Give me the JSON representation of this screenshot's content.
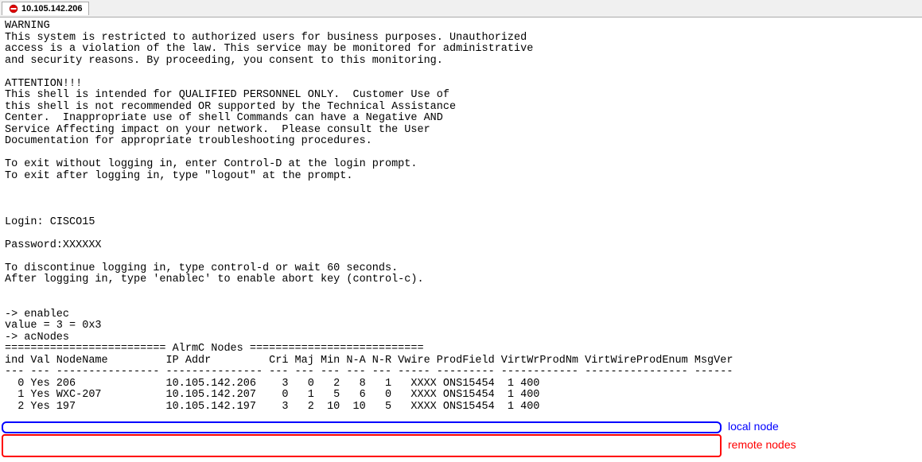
{
  "tab": {
    "title": "10.105.142.206"
  },
  "terminal": {
    "warning_header": "WARNING",
    "warning_lines": [
      "This system is restricted to authorized users for business purposes. Unauthorized",
      "access is a violation of the law. This service may be monitored for administrative",
      "and security reasons. By proceeding, you consent to this monitoring."
    ],
    "attention_header": "ATTENTION!!!",
    "attention_lines": [
      "This shell is intended for QUALIFIED PERSONNEL ONLY.  Customer Use of",
      "this shell is not recommended OR supported by the Technical Assistance",
      "Center.  Inappropriate use of shell Commands can have a Negative AND",
      "Service Affecting impact on your network.  Please consult the User",
      "Documentation for appropriate troubleshooting procedures."
    ],
    "exit_lines": [
      "To exit without logging in, enter Control-D at the login prompt.",
      "To exit after logging in, type \"logout\" at the prompt."
    ],
    "login_label": "Login: ",
    "login_value": "CISCO15",
    "password_label": "Password:",
    "password_value": "XXXXXX",
    "post_login_lines": [
      "To discontinue logging in, type control-d or wait 60 seconds.",
      "After logging in, type 'enablec' to enable abort key (control-c)."
    ],
    "prompt1": "-> enablec",
    "value_line": "value = 3 = 0x3",
    "prompt2": "-> acNodes",
    "table_header_sep": "========================= AlrmC Nodes ===========================",
    "table_columns": "ind Val NodeName         IP Addr         Cri Maj Min N-A N-R Vwire ProdField VirtWrProdNm VirtWireProdEnum MsgVer",
    "table_underline": "--- --- ---------------- --------------- --- --- --- --- --- ----- --------- ------------ ---------------- ------",
    "rows": [
      {
        "ind": "0",
        "val": "Yes",
        "node": "206",
        "ip": "10.105.142.206",
        "cri": "3",
        "maj": "0",
        "min": "2",
        "na": "8",
        "nr": "1",
        "vwire": "XXXX",
        "prod": "ONS15454",
        "virtwr": "1",
        "msgver": "400"
      },
      {
        "ind": "1",
        "val": "Yes",
        "node": "WXC-207",
        "ip": "10.105.142.207",
        "cri": "0",
        "maj": "1",
        "min": "5",
        "na": "6",
        "nr": "0",
        "vwire": "XXXX",
        "prod": "ONS15454",
        "virtwr": "1",
        "msgver": "400"
      },
      {
        "ind": "2",
        "val": "Yes",
        "node": "197",
        "ip": "10.105.142.197",
        "cri": "3",
        "maj": "2",
        "min": "10",
        "na": "10",
        "nr": "5",
        "vwire": "XXXX",
        "prod": "ONS15454",
        "virtwr": "1",
        "msgver": "400"
      }
    ]
  },
  "annotations": {
    "local_label": "local node",
    "remote_label": "remote nodes"
  }
}
